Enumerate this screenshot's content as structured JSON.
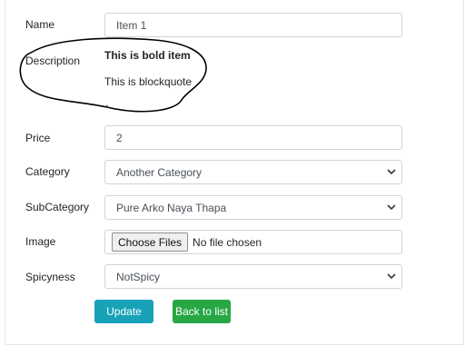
{
  "form": {
    "name": {
      "label": "Name",
      "value": "Item 1"
    },
    "description": {
      "label": "Description",
      "bold_line": "This is bold item",
      "quote_line": "This is blockquote",
      "trailing": "."
    },
    "price": {
      "label": "Price",
      "value": "2"
    },
    "category": {
      "label": "Category",
      "value": "Another Category"
    },
    "subcategory": {
      "label": "SubCategory",
      "value": "Pure Arko Naya Thapa"
    },
    "image": {
      "label": "Image",
      "button": "Choose Files",
      "status": "No file chosen"
    },
    "spicyness": {
      "label": "Spicyness",
      "value": "NotSpicy"
    }
  },
  "buttons": {
    "update": "Update",
    "back": "Back to list"
  },
  "colors": {
    "update_bg": "#17a2b8",
    "back_bg": "#28a745",
    "input_border": "#ced4da",
    "annotation_ink": "#000000"
  },
  "icons": {
    "select_arrow": "chevron-down-icon"
  }
}
